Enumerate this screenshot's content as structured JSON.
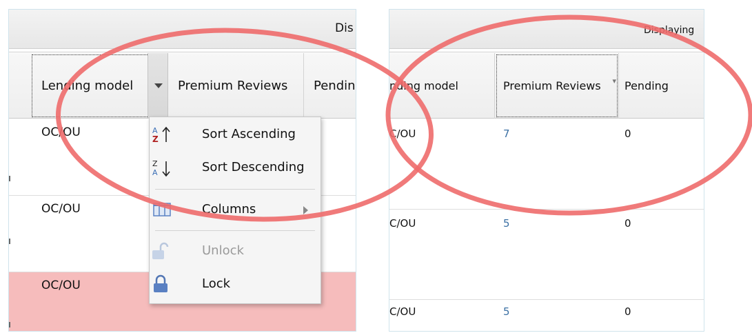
{
  "left_panel": {
    "display_text": "Dis",
    "columns": {
      "lending_model": "Lending model",
      "premium_reviews": "Premium Reviews",
      "pending": "Pendin"
    },
    "rows": [
      {
        "lending_model": "OC/OU",
        "highlighted": false
      },
      {
        "lending_model": "OC/OU",
        "highlighted": false
      },
      {
        "lending_model": "OC/OU",
        "highlighted": true
      }
    ]
  },
  "column_menu": {
    "items": [
      {
        "label": "Sort Ascending",
        "icon": "sort-ascending-icon",
        "enabled": true
      },
      {
        "label": "Sort Descending",
        "icon": "sort-descending-icon",
        "enabled": true
      },
      {
        "label": "Columns",
        "icon": "columns-icon",
        "enabled": true,
        "has_submenu": true
      },
      {
        "label": "Unlock",
        "icon": "unlock-icon",
        "enabled": false
      },
      {
        "label": "Lock",
        "icon": "lock-icon",
        "enabled": true
      }
    ]
  },
  "right_panel": {
    "display_text": "Displaying",
    "columns": {
      "lending_model": "nding model",
      "premium_reviews": "Premium Reviews",
      "pending": "Pending"
    },
    "rows": [
      {
        "lending_model": "C/OU",
        "premium_reviews": "7",
        "pending": "0"
      },
      {
        "lending_model": "C/OU",
        "premium_reviews": "5",
        "pending": "0"
      },
      {
        "lending_model": "C/OU",
        "premium_reviews": "5",
        "pending": "0"
      }
    ]
  },
  "colors": {
    "annotation_red": "#ee6b6b",
    "highlight_row": "#f6bcbc",
    "link_blue": "#3a6fa3",
    "panel_border": "#cfe3ec"
  }
}
